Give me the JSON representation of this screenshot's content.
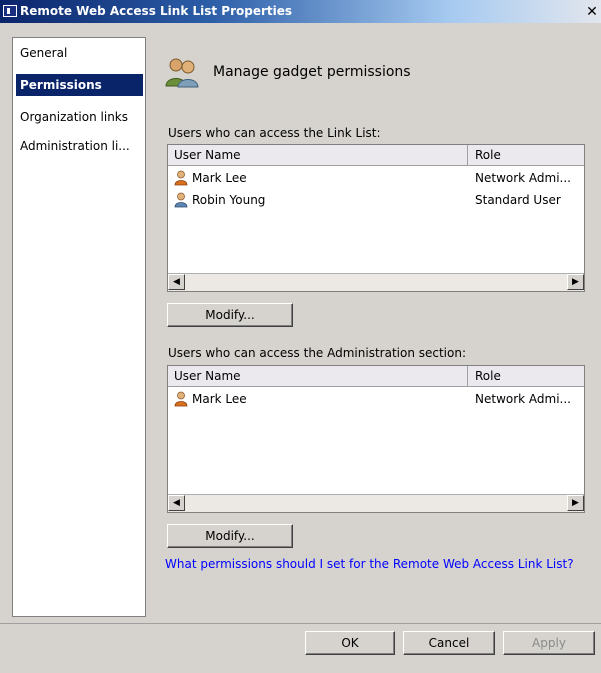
{
  "window": {
    "title": "Remote Web Access Link List Properties",
    "close_glyph": "✕"
  },
  "nav": {
    "items": [
      {
        "label": "General",
        "selected": false
      },
      {
        "label": "Permissions",
        "selected": true
      },
      {
        "label": "Organization links",
        "selected": false
      },
      {
        "label": "Administration li...",
        "selected": false
      }
    ]
  },
  "header": {
    "title": "Manage gadget permissions",
    "icon": "users-group-icon"
  },
  "link_list_section": {
    "label": "Users who can access the Link List:",
    "columns": [
      "User Name",
      "Role"
    ],
    "rows": [
      {
        "name": "Mark Lee",
        "role": "Network Admi...",
        "icon": "user-admin-icon"
      },
      {
        "name": "Robin Young",
        "role": "Standard User",
        "icon": "user-icon"
      }
    ],
    "modify_label": "Modify..."
  },
  "admin_section": {
    "label": "Users who can access the Administration section:",
    "columns": [
      "User Name",
      "Role"
    ],
    "rows": [
      {
        "name": "Mark Lee",
        "role": "Network Admi...",
        "icon": "user-admin-icon"
      }
    ],
    "modify_label": "Modify..."
  },
  "help_link": "What permissions should I set for the Remote Web Access Link List?",
  "buttons": {
    "ok": "OK",
    "cancel": "Cancel",
    "apply": "Apply"
  }
}
